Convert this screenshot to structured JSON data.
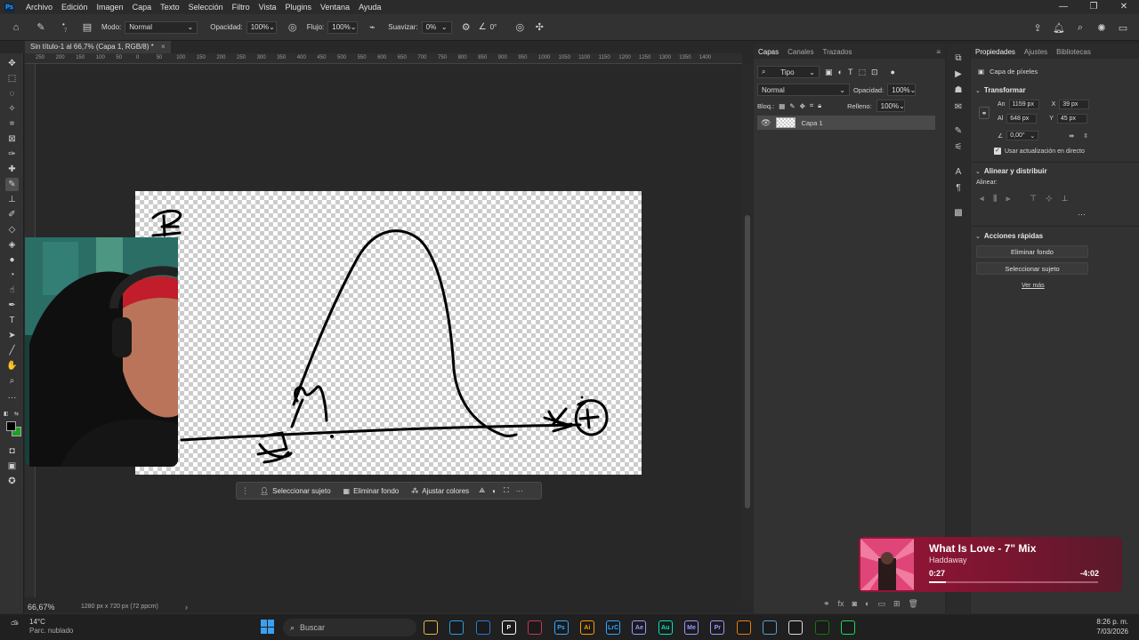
{
  "app": {
    "menu": [
      "Archivo",
      "Edición",
      "Imagen",
      "Capa",
      "Texto",
      "Selección",
      "Filtro",
      "Vista",
      "Plugins",
      "Ventana",
      "Ayuda"
    ],
    "window_controls": {
      "minimize": "—",
      "maximize": "❐",
      "close": "✕"
    }
  },
  "options": {
    "mode_label": "Modo:",
    "mode_value": "Normal",
    "opacity_label": "Opacidad:",
    "opacity_value": "100%",
    "flow_label": "Flujo:",
    "flow_value": "100%",
    "smooth_label": "Suavizar:",
    "smooth_value": "0%",
    "angle_value": "0°",
    "brush_size": "7"
  },
  "document": {
    "tab_title": "Sin título-1 al 66,7% (Capa 1, RGB/8) *",
    "close": "×",
    "ruler_ticks": [
      "250",
      "200",
      "150",
      "100",
      "50",
      "0",
      "50",
      "100",
      "150",
      "200",
      "250",
      "300",
      "350",
      "400",
      "450",
      "500",
      "550",
      "600",
      "650",
      "700",
      "750",
      "800",
      "850",
      "900",
      "950",
      "1000",
      "1050",
      "1100",
      "1150",
      "1200",
      "1250",
      "1300",
      "1350",
      "1400"
    ]
  },
  "context_bar": {
    "select_subject": "Seleccionar sujeto",
    "remove_bg": "Eliminar fondo",
    "adjust_colors": "Ajustar colores",
    "more": "···"
  },
  "status": {
    "zoom": "66,67%",
    "dimensions": "1280 px x 720 px (72 ppcm)",
    "arrow": "›"
  },
  "layers_panel": {
    "tabs": [
      "Capas",
      "Canales",
      "Trazados"
    ],
    "filter_label": "Tipo",
    "blend_mode": "Normal",
    "opacity_label": "Opacidad:",
    "opacity_value": "100%",
    "lock_label": "Bloq.:",
    "fill_label": "Relleno:",
    "fill_value": "100%",
    "layers": [
      {
        "name": "Capa 1"
      }
    ]
  },
  "properties": {
    "tabs": [
      "Propiedades",
      "Ajustes",
      "Bibliotecas"
    ],
    "kind": "Capa de píxeles",
    "transform_title": "Transformar",
    "w_label": "An",
    "w_value": "1159 px",
    "h_label": "Al",
    "h_value": "648 px",
    "x_label": "X",
    "x_value": "39 px",
    "y_label": "Y",
    "y_value": "45 px",
    "angle_value": "0,00°",
    "live_update": "Usar actualización en directo",
    "align_title": "Alinear y distribuir",
    "align_label": "Alinear:",
    "quick_title": "Acciones rápidas",
    "remove_bg": "Eliminar fondo",
    "select_subject": "Seleccionar sujeto",
    "see_more": "Ver más"
  },
  "music": {
    "title": "What Is Love - 7\" Mix",
    "artist": "Haddaway",
    "elapsed": "0:27",
    "remaining": "-4:02",
    "progress": 0.1
  },
  "taskbar": {
    "weather_temp": "14°C",
    "weather_desc": "Parc. nublado",
    "search_placeholder": "Buscar",
    "time": "8:26 p. m.",
    "date": "7/03/2026",
    "apps": [
      {
        "name": "file-explorer-icon",
        "label": "",
        "color": "#e8b84a"
      },
      {
        "name": "edge-icon",
        "label": "",
        "color": "#2aa0e0"
      },
      {
        "name": "store-icon",
        "label": "",
        "color": "#2a7ad8"
      },
      {
        "name": "app-icon",
        "label": "P",
        "color": "#ffffff"
      },
      {
        "name": "app-icon-2",
        "label": "",
        "color": "#c8385a"
      },
      {
        "name": "photoshop-icon",
        "label": "Ps",
        "color": "#31a8ff"
      },
      {
        "name": "illustrator-icon",
        "label": "Ai",
        "color": "#ff9a00"
      },
      {
        "name": "lightroom-classic-icon",
        "label": "LrC",
        "color": "#31a8ff"
      },
      {
        "name": "after-effects-icon",
        "label": "Ae",
        "color": "#9999ff"
      },
      {
        "name": "audition-icon",
        "label": "Au",
        "color": "#00e4bb"
      },
      {
        "name": "media-encoder-icon",
        "label": "Me",
        "color": "#9999ff"
      },
      {
        "name": "premiere-icon",
        "label": "Pr",
        "color": "#9999ff"
      },
      {
        "name": "blender-icon",
        "label": "",
        "color": "#e87d0d"
      },
      {
        "name": "app-icon-3",
        "label": "",
        "color": "#5aa0d0"
      },
      {
        "name": "github-icon",
        "label": "",
        "color": "#dddddd"
      },
      {
        "name": "xbox-icon",
        "label": "",
        "color": "#107c10"
      },
      {
        "name": "spotify-icon",
        "label": "",
        "color": "#1ed760"
      }
    ]
  }
}
